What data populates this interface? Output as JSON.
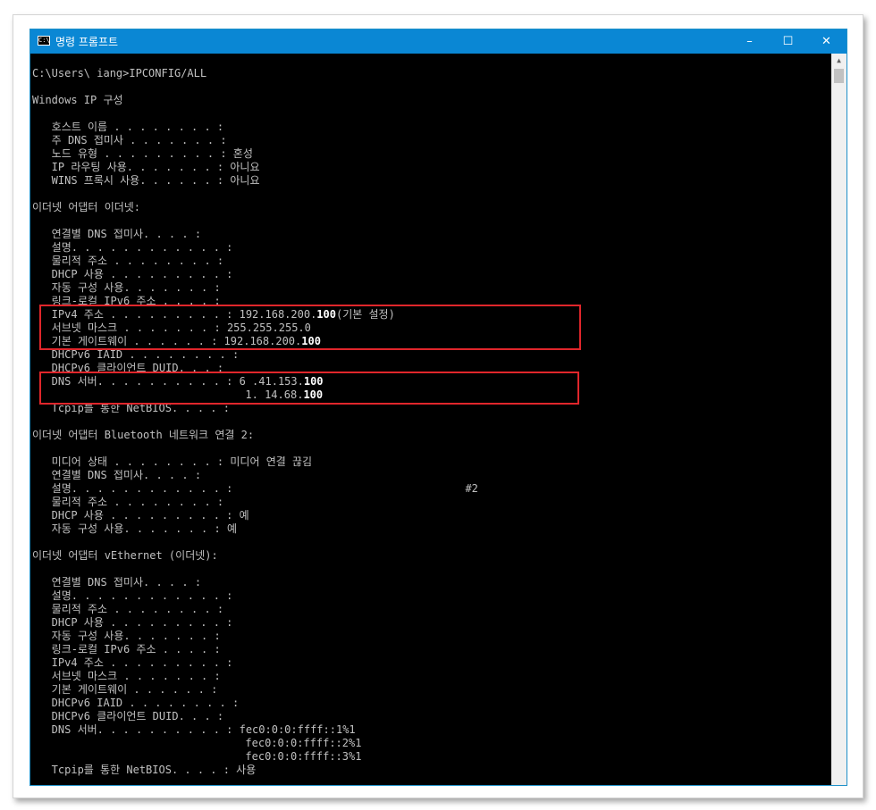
{
  "window": {
    "title": "명령 프롬프트",
    "icon_label": "C:\\",
    "controls": {
      "minimize": "–",
      "maximize": "☐",
      "close": "✕"
    }
  },
  "console": {
    "lines": [
      "C:\\Users\\ iang>IPCONFIG/ALL",
      "",
      "Windows IP 구성",
      "",
      "   호스트 이름 . . . . . . . . :",
      "   주 DNS 접미사 . . . . . . . :",
      "   노드 유형 . . . . . . . . . : 혼성",
      "   IP 라우팅 사용. . . . . . . : 아니요",
      "   WINS 프록시 사용. . . . . . : 아니요",
      "",
      "이더넷 어댑터 이더넷:",
      "",
      "   연결별 DNS 접미사. . . . :",
      "   설명. . . . . . . . . . . . :",
      "   물리적 주소 . . . . . . . . :",
      "   DHCP 사용 . . . . . . . . . :",
      "   자동 구성 사용. . . . . . . :",
      "   링크-로컬 IPv6 주소 . . . . :",
      "   IPv4 주소 . . . . . . . . . : 192.168.200.**100**(기본 설정)",
      "   서브넷 마스크 . . . . . . . : 255.255.255.0",
      "   기본 게이트웨이 . . . . . . : 192.168.200.**100**",
      "   DHCPv6 IAID . . . . . . . . :",
      "   DHCPv6 클라이언트 DUID. . . :",
      "   DNS 서버. . . . . . . . . . : 6 .41.153.**100**",
      "                                 1. 14.68.**100**",
      "   Tcpip를 통한 NetBIOS. . . . :",
      "",
      "이더넷 어댑터 Bluetooth 네트워크 연결 2:",
      "",
      "   미디어 상태 . . . . . . . . : 미디어 연결 끊김",
      "   연결별 DNS 접미사. . . . :",
      "   설명. . . . . . . . . . . . :                                    #2",
      "   물리적 주소 . . . . . . . . :",
      "   DHCP 사용 . . . . . . . . . : 예",
      "   자동 구성 사용. . . . . . . : 예",
      "",
      "이더넷 어댑터 vEthernet (이더넷):",
      "",
      "   연결별 DNS 접미사. . . . :",
      "   설명. . . . . . . . . . . . :",
      "   물리적 주소 . . . . . . . . :",
      "   DHCP 사용 . . . . . . . . . :",
      "   자동 구성 사용. . . . . . . :",
      "   링크-로컬 IPv6 주소 . . . . :",
      "   IPv4 주소 . . . . . . . . . :",
      "   서브넷 마스크 . . . . . . . :",
      "   기본 게이트웨이 . . . . . . :",
      "   DHCPv6 IAID . . . . . . . . :",
      "   DHCPv6 클라이언트 DUID. . . :",
      "   DNS 서버. . . . . . . . . . : fec0:0:0:ffff::1%1",
      "                                 fec0:0:0:ffff::2%1",
      "                                 fec0:0:0:ffff::3%1",
      "   Tcpip를 통한 NetBIOS. . . . : 사용"
    ]
  },
  "highlight_color": "#e0262b"
}
